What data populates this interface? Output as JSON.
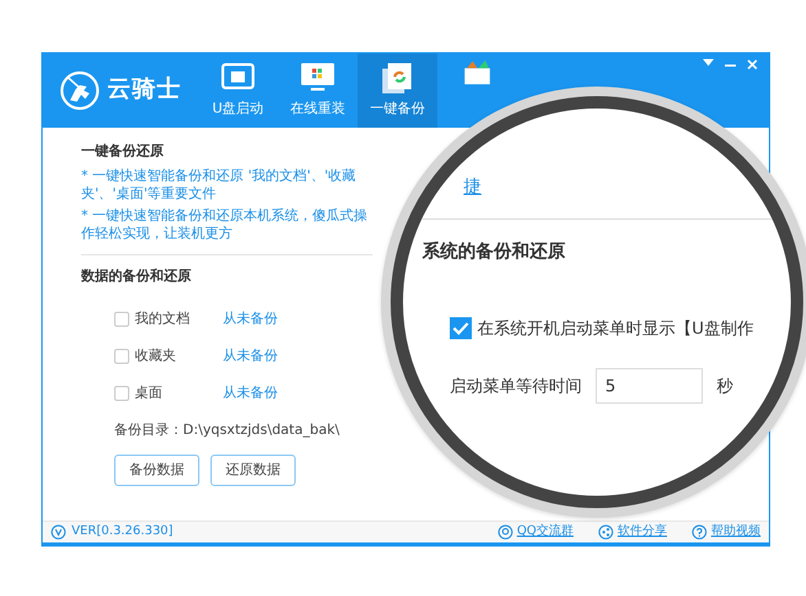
{
  "window": {
    "logo_text": "云骑士",
    "tabs": [
      {
        "kind": "usb",
        "label": "U盘启动",
        "selected": false
      },
      {
        "kind": "monitor",
        "label": "在线重装",
        "selected": false
      },
      {
        "kind": "backup",
        "label": "一键备份",
        "selected": true
      },
      {
        "kind": "toolbox",
        "selected": false
      }
    ]
  },
  "backup_section": {
    "title": "一键备份还原",
    "notes": [
      "* 一键快速智能备份和还原 '我的文档'、'收藏夹'、'桌面'等重要文件",
      "* 一键快速智能备份和还原本机系统，傻瓜式操作轻松实现，让装机更方"
    ]
  },
  "data_section": {
    "title": "数据的备份和还原",
    "items": [
      {
        "label": "我的文档",
        "checked": false,
        "status": "从未备份"
      },
      {
        "label": "收藏夹",
        "checked": false,
        "status": "从未备份"
      },
      {
        "label": "桌面",
        "checked": false,
        "status": "从未备份"
      }
    ],
    "dir_label": "备份目录：",
    "dir_path": "D:\\yqsxtzjds\\data_bak\\",
    "buttons": [
      "备份数据",
      "还原数据"
    ]
  },
  "status_bar": {
    "version": "VER[0.3.26.330]",
    "links": [
      {
        "kind": "qq",
        "label": "QQ交流群"
      },
      {
        "kind": "share",
        "label": "软件分享"
      },
      {
        "kind": "help",
        "label": "帮助视频"
      }
    ]
  },
  "magnifier": {
    "link_fragment": "捷",
    "title": "系统的备份和还原",
    "option": {
      "label": "在系统开机启动菜单时显示【U盘制作",
      "checked": true
    },
    "wait_label": "启动菜单等待时间",
    "wait_value": "5",
    "unit": "秒"
  }
}
